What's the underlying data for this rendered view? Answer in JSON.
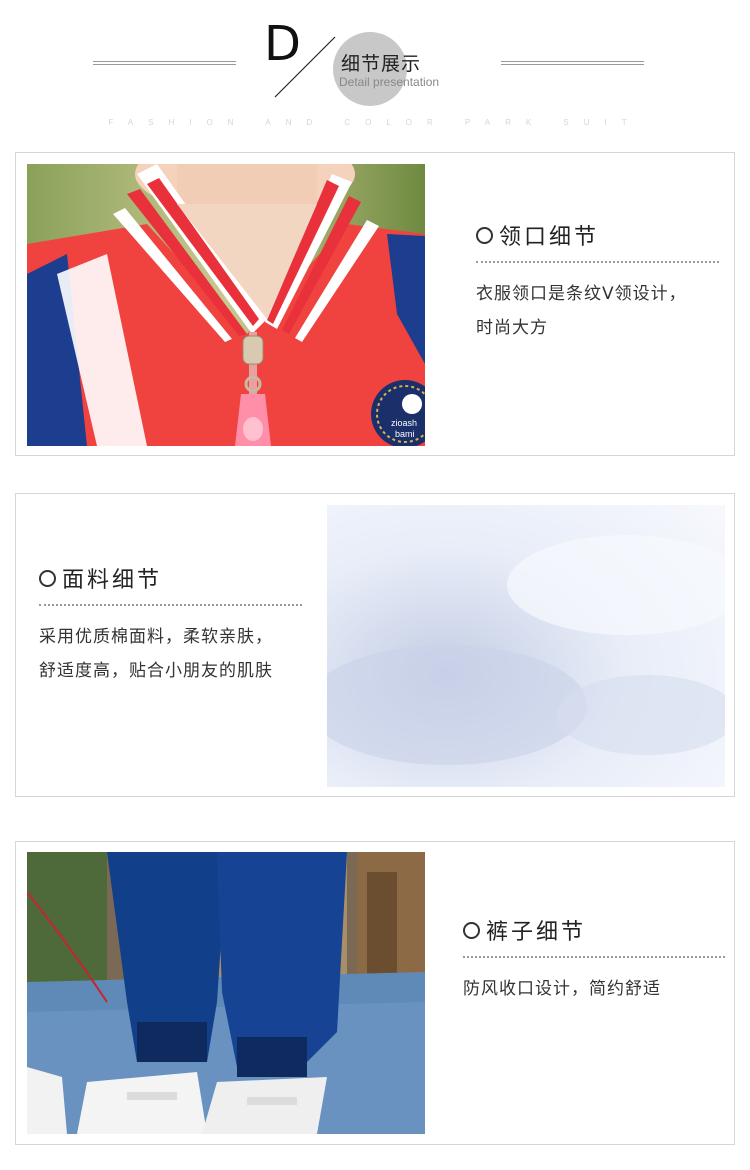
{
  "header": {
    "letter": "D",
    "title_cn": "细节展示",
    "title_en": "Detail presentation",
    "tagline": "FASHION AND COLOR PARK SUIT"
  },
  "sections": [
    {
      "title": "领口细节",
      "desc_lines": [
        "衣服领口是条纹V领设计，",
        "时尚大方"
      ],
      "badge_text": [
        "zioash",
        "bami"
      ]
    },
    {
      "title": "面料细节",
      "desc_lines": [
        "采用优质棉面料，柔软亲肤，",
        "舒适度高，贴合小朋友的肌肤"
      ]
    },
    {
      "title": "裤子细节",
      "desc_lines": [
        "防风收口设计，简约舒适"
      ]
    }
  ],
  "colors": {
    "red": "#f0433f",
    "navy": "#1d3d8f",
    "white": "#ffffff",
    "fabric": "#dde6f5",
    "pants": "#123f8a",
    "floor": "#5f8ab8"
  }
}
